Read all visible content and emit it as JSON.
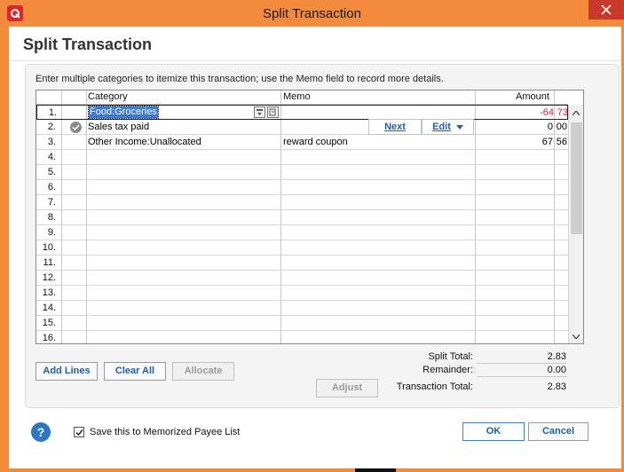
{
  "window": {
    "title": "Split Transaction"
  },
  "dialog": {
    "heading": "Split Transaction",
    "instructions": "Enter multiple categories to itemize this transaction; use the Memo field to record more details."
  },
  "grid": {
    "columns": {
      "category": "Category",
      "memo": "Memo",
      "amount": "Amount"
    },
    "rows": [
      {
        "num": "1.",
        "category": "Food:Groceries",
        "memo": "",
        "amount": "-64",
        "cents": "73"
      },
      {
        "num": "2.",
        "category": "Sales tax paid",
        "memo": "",
        "amount": "0",
        "cents": "00"
      },
      {
        "num": "3.",
        "category": "Other Income:Unallocated",
        "memo": "reward coupon",
        "amount": "67",
        "cents": "56"
      },
      {
        "num": "4."
      },
      {
        "num": "5."
      },
      {
        "num": "6."
      },
      {
        "num": "7."
      },
      {
        "num": "8."
      },
      {
        "num": "9."
      },
      {
        "num": "10."
      },
      {
        "num": "11."
      },
      {
        "num": "12."
      },
      {
        "num": "13."
      },
      {
        "num": "14."
      },
      {
        "num": "15."
      },
      {
        "num": "16."
      }
    ],
    "row_buttons": {
      "next": "Next",
      "edit": "Edit"
    }
  },
  "buttons": {
    "add_lines": "Add Lines",
    "clear_all": "Clear All",
    "allocate": "Allocate",
    "adjust": "Adjust",
    "ok": "OK",
    "cancel": "Cancel"
  },
  "totals": {
    "split_total_label": "Split Total:",
    "split_total": "2.83",
    "remainder_label": "Remainder:",
    "remainder": "0.00",
    "transaction_total_label": "Transaction Total:",
    "transaction_total": "2.83"
  },
  "footer": {
    "memorize_label": "Save this to Memorized Payee List",
    "memorize_checked": true,
    "help": "?"
  },
  "colors": {
    "accent": "#1b5fb3",
    "negative": "#e0202a",
    "selection": "#3a7bd5",
    "titlebar": "#f28b3c"
  }
}
